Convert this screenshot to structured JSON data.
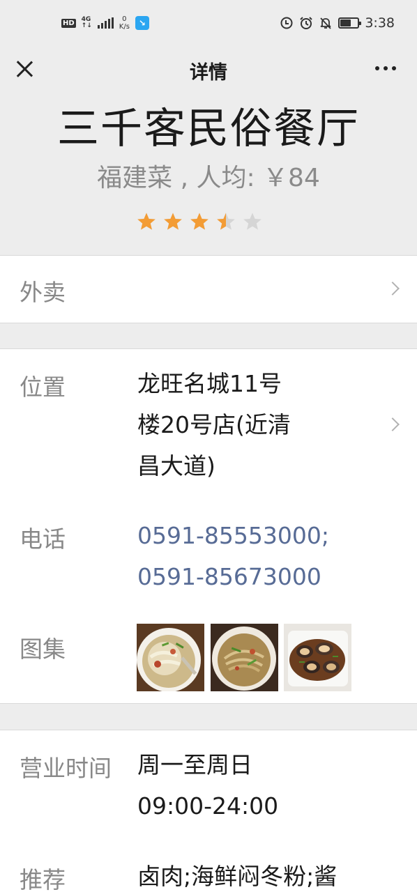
{
  "status": {
    "hd": "HD",
    "network_top": "4G",
    "network_bottom": "↑↓",
    "speed_value": "0",
    "speed_unit": "K/s",
    "battery_level": 0.55,
    "time": "3:38"
  },
  "nav": {
    "title": "详情"
  },
  "restaurant": {
    "name": "三千客民俗餐厅",
    "subtitle": "福建菜 , 人均: ￥84",
    "rating": 3.5,
    "rating_max": 5,
    "star_color": "#f39c35",
    "star_empty_color": "#d5d5d5"
  },
  "takeout": {
    "label": "外卖"
  },
  "info": {
    "location_label": "位置",
    "location_lines": [
      "龙旺名城11号",
      "楼20号店(近清",
      "昌大道)"
    ],
    "phone_label": "电话",
    "phone_lines": [
      "0591-85553000;",
      "0591-85673000"
    ],
    "gallery_label": "图集",
    "gallery_images": [
      "noodle-soup-photo",
      "noodle-bowl-photo",
      "clams-photo"
    ]
  },
  "hours": {
    "label": "营业时间",
    "lines": [
      "周一至周日",
      "09:00-24:00"
    ],
    "recommend_label": "推荐",
    "recommend_text": "卤肉;海鲜闷冬粉;酱"
  }
}
